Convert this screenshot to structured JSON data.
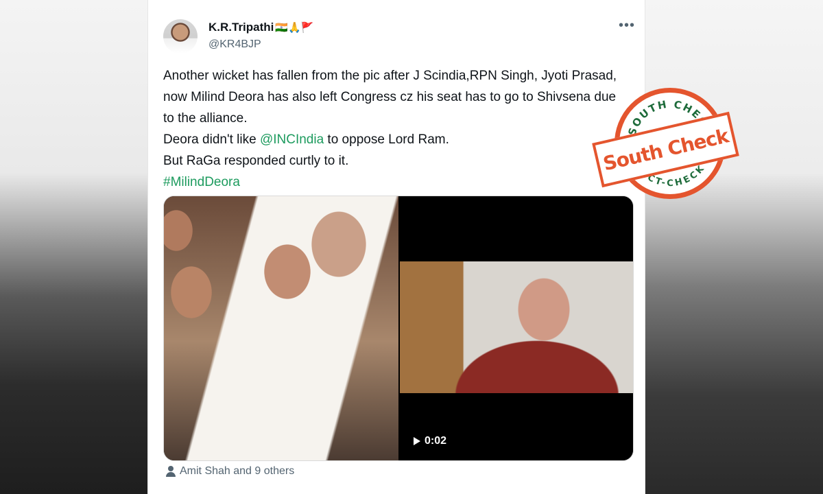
{
  "tweet": {
    "author_name": "K.R.Tripathi",
    "author_emojis": "🇮🇳🙏🚩",
    "handle": "@KR4BJP",
    "more_icon": "more-horizontal-icon",
    "lines": {
      "l1": "Another wicket has fallen from the pic after J Scindia,RPN Singh, Jyoti Prasad, now Milind Deora has also left Congress cz his seat has to go to Shivsena due to the alliance.",
      "l2_pre": "Deora didn't like ",
      "l2_mention": "@INCIndia",
      "l2_post": " to oppose Lord Ram.",
      "l3": "But RaGa responded curtly to it.",
      "hashtag": "#MilindDeora"
    },
    "video_time": "0:02",
    "liked_by": "Amit Shah and 9 others"
  },
  "stamp": {
    "top_text": "SOUTH CHECK",
    "bottom_text": "FACT-CHECK",
    "banner_text": "South Check",
    "color": "#e4552e"
  }
}
